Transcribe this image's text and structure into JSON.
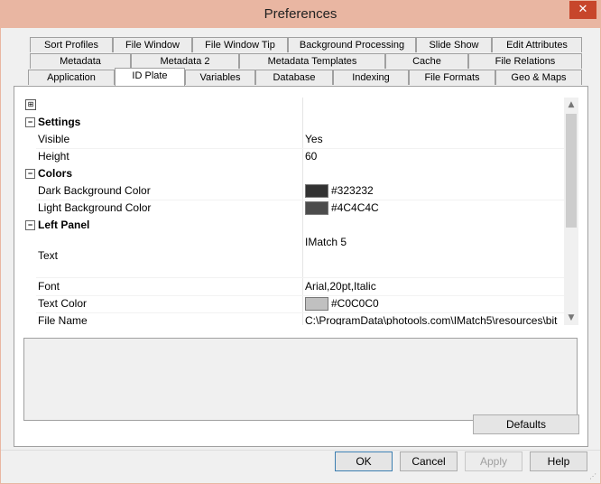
{
  "window": {
    "title": "Preferences",
    "close_symbol": "✕"
  },
  "tabs": {
    "row1": [
      "Sort Profiles",
      "File Window",
      "File Window Tip",
      "Background Processing",
      "Slide Show",
      "Edit Attributes"
    ],
    "row2": [
      "Metadata",
      "Metadata 2",
      "Metadata Templates",
      "Cache",
      "File Relations"
    ],
    "row3": [
      "Application",
      "ID Plate",
      "Variables",
      "Database",
      "Indexing",
      "File Formats",
      "Geo & Maps"
    ],
    "active": "ID Plate"
  },
  "grid": {
    "categories": {
      "settings": "Settings",
      "colors": "Colors",
      "left_panel": "Left Panel"
    },
    "props": {
      "visible": {
        "name": "Visible",
        "value": "Yes"
      },
      "height": {
        "name": "Height",
        "value": "60"
      },
      "dark_bg": {
        "name": "Dark Background Color",
        "value": "#323232",
        "color": "#323232"
      },
      "light_bg": {
        "name": "Light Background Color",
        "value": "#4C4C4C",
        "color": "#4C4C4C"
      },
      "text": {
        "name": "Text",
        "value": "IMatch 5"
      },
      "font": {
        "name": "Font",
        "value": "Arial,20pt,Italic"
      },
      "text_color": {
        "name": "Text Color",
        "value": "#C0C0C0",
        "color": "#C0C0C0"
      },
      "file_name": {
        "name": "File Name",
        "value": "C:\\ProgramData\\photools.com\\IMatch5\\resources\\bit"
      }
    }
  },
  "buttons": {
    "defaults": "Defaults",
    "ok": "OK",
    "cancel": "Cancel",
    "apply": "Apply",
    "help": "Help"
  },
  "colors": {
    "titlebar": "#e9b6a2",
    "close": "#c7462b"
  }
}
